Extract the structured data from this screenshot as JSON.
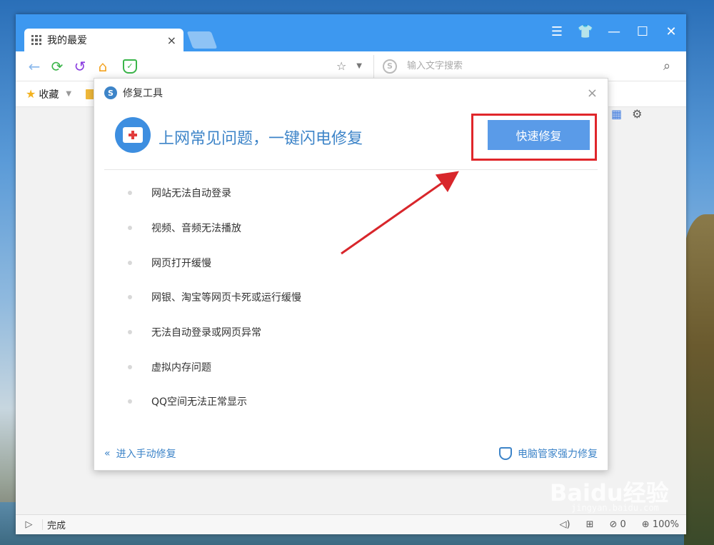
{
  "browser": {
    "tab_title": "我的最爱",
    "tab_close": "×",
    "window_controls": [
      "☰",
      "👕",
      "—",
      "☐",
      "✕"
    ],
    "nav": {
      "back": "←",
      "refresh": "⟳",
      "undo": "↺",
      "home": "⌂",
      "shield": "✓"
    },
    "search_placeholder": "输入文字搜索",
    "search_logo": "S",
    "favorites_label": "收藏",
    "status_text": "完成",
    "status_count": "0",
    "zoom": "100%"
  },
  "dialog": {
    "title": "修复工具",
    "close": "×",
    "hero_text": "上网常见问题，一键闪电修复",
    "quick_fix_button": "快速修复",
    "problems": [
      "网站无法自动登录",
      "视频、音频无法播放",
      "网页打开缓慢",
      "网银、淘宝等网页卡死或运行缓慢",
      "无法自动登录或网页异常",
      "虚拟内存问题",
      "QQ空间无法正常显示"
    ],
    "manual_repair": "进入手动修复",
    "manual_icon": "«",
    "strong_repair": "电脑管家强力修复"
  },
  "colors": {
    "accent": "#3d84c8",
    "titlebar": "#3d98f0",
    "button": "#5a9be8",
    "highlight": "#e0262b"
  },
  "watermark": {
    "main": "Baidu经验",
    "sub": "jingyan.baidu.com"
  }
}
